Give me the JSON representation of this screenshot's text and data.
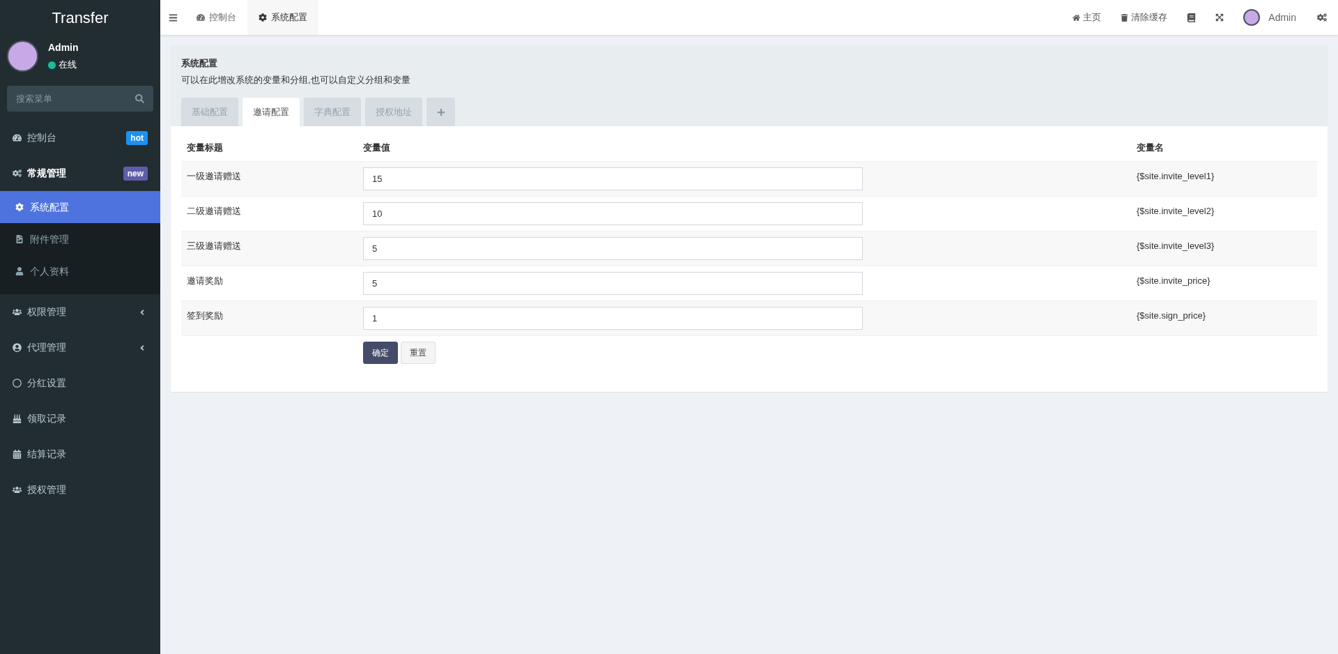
{
  "brand": "Transfer",
  "user": {
    "name": "Admin",
    "status": "在线"
  },
  "sidebar": {
    "search": {
      "placeholder": "搜索菜单"
    },
    "items": [
      {
        "label": "控制台",
        "selected": false,
        "badge": {
          "text": "hot",
          "color": "#1e90f0"
        }
      },
      {
        "label": "常规管理",
        "selected": false,
        "expanded": true,
        "badge": {
          "text": "new",
          "color": "#605ca8"
        },
        "children": [
          {
            "label": "系统配置",
            "selected": true
          },
          {
            "label": "附件管理",
            "selected": false
          },
          {
            "label": "个人资料",
            "selected": false
          }
        ]
      },
      {
        "label": "权限管理",
        "selected": false,
        "expanded": false
      },
      {
        "label": "代理管理",
        "selected": false,
        "expanded": false
      },
      {
        "label": "分红设置",
        "selected": false
      },
      {
        "label": "领取记录",
        "selected": false
      },
      {
        "label": "结算记录",
        "selected": false
      },
      {
        "label": "授权管理",
        "selected": false
      }
    ]
  },
  "topbar": {
    "tabs": [
      {
        "label": "控制台",
        "selected": false
      },
      {
        "label": "系统配置",
        "selected": true
      }
    ],
    "links": [
      "主页",
      "清除缓存"
    ],
    "user": "Admin"
  },
  "panel": {
    "title": "系统配置",
    "description": "可以在此增改系统的变量和分组,也可以自定义分组和变量",
    "tabs": [
      {
        "label": "基础配置",
        "selected": false
      },
      {
        "label": "邀请配置",
        "selected": true
      },
      {
        "label": "字典配置",
        "selected": false
      },
      {
        "label": "授权地址",
        "selected": false
      }
    ],
    "table": {
      "columns": [
        "变量标题",
        "变量值",
        "变量名"
      ],
      "rows": [
        {
          "title": "一级邀请赠送",
          "value": "15",
          "name": "{$site.invite_level1}"
        },
        {
          "title": "二级邀请赠送",
          "value": "10",
          "name": "{$site.invite_level2}"
        },
        {
          "title": "三级邀请赠送",
          "value": "5",
          "name": "{$site.invite_level3}"
        },
        {
          "title": "邀请奖励",
          "value": "5",
          "name": "{$site.invite_price}"
        },
        {
          "title": "签到奖励",
          "value": "1",
          "name": "{$site.sign_price}"
        }
      ]
    },
    "buttons": [
      {
        "label": "确定",
        "kind": "primary"
      },
      {
        "label": "重置",
        "kind": "default"
      }
    ]
  }
}
